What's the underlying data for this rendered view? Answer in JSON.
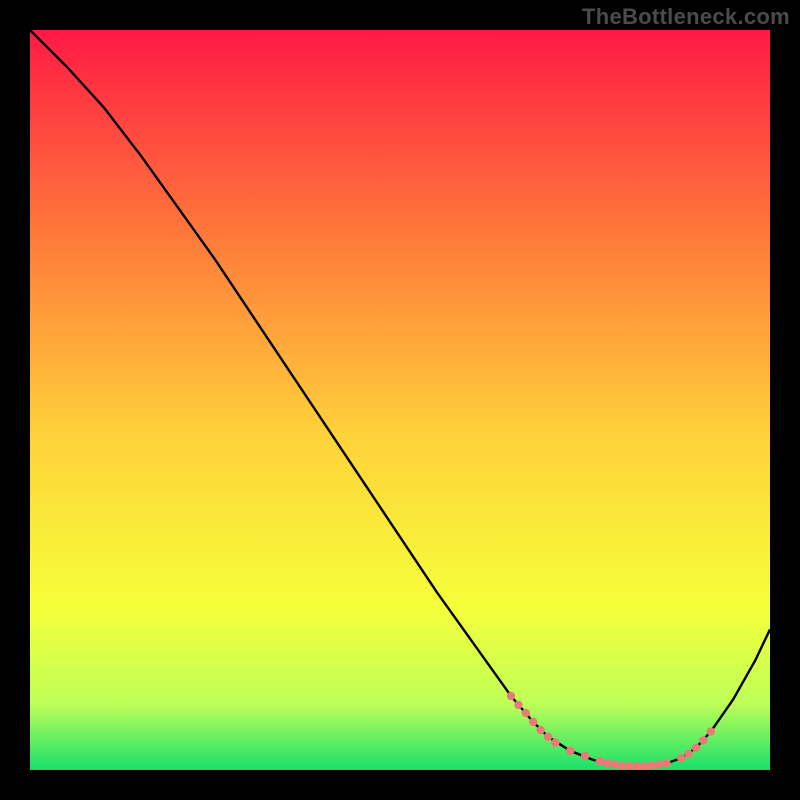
{
  "watermark": "TheBottleneck.com",
  "colors": {
    "background": "#000000",
    "gradient_top": "#ff1a44",
    "gradient_mid_upper": "#ff7a3a",
    "gradient_mid": "#ffd23a",
    "gradient_mid_lower": "#f6ff3a",
    "gradient_lower": "#bfff57",
    "gradient_bottom": "#18e06a",
    "curve": "#000000",
    "markers": "#e97a78"
  },
  "chart_data": {
    "type": "line",
    "title": "",
    "xlabel": "",
    "ylabel": "",
    "xlim": [
      0,
      100
    ],
    "ylim": [
      0,
      100
    ],
    "grid": false,
    "series": [
      {
        "name": "bottleneck-curve",
        "x": [
          0,
          5,
          10,
          15,
          20,
          25,
          30,
          35,
          40,
          45,
          50,
          55,
          60,
          65,
          68,
          70,
          73,
          76,
          78,
          80,
          82,
          84,
          86,
          88,
          90,
          92,
          95,
          98,
          100
        ],
        "y": [
          100,
          95,
          89.5,
          83,
          76,
          69,
          61.5,
          54,
          46.5,
          39,
          31.5,
          24,
          17,
          10,
          6.5,
          4.5,
          2.6,
          1.4,
          0.9,
          0.6,
          0.5,
          0.6,
          0.9,
          1.6,
          3,
          5.2,
          9.5,
          14.8,
          19
        ]
      }
    ],
    "markers": {
      "name": "highlight-region",
      "x": [
        65,
        66,
        67,
        68,
        69,
        70,
        71,
        73,
        75,
        77,
        78,
        79,
        80,
        81,
        82,
        83,
        84,
        85,
        86,
        88,
        89,
        90,
        91,
        92
      ],
      "y": [
        10,
        8.8,
        7.7,
        6.5,
        5.4,
        4.5,
        3.7,
        2.6,
        1.9,
        1.2,
        0.9,
        0.75,
        0.6,
        0.55,
        0.5,
        0.53,
        0.6,
        0.73,
        0.9,
        1.6,
        2.2,
        3,
        4,
        5.2
      ]
    }
  }
}
